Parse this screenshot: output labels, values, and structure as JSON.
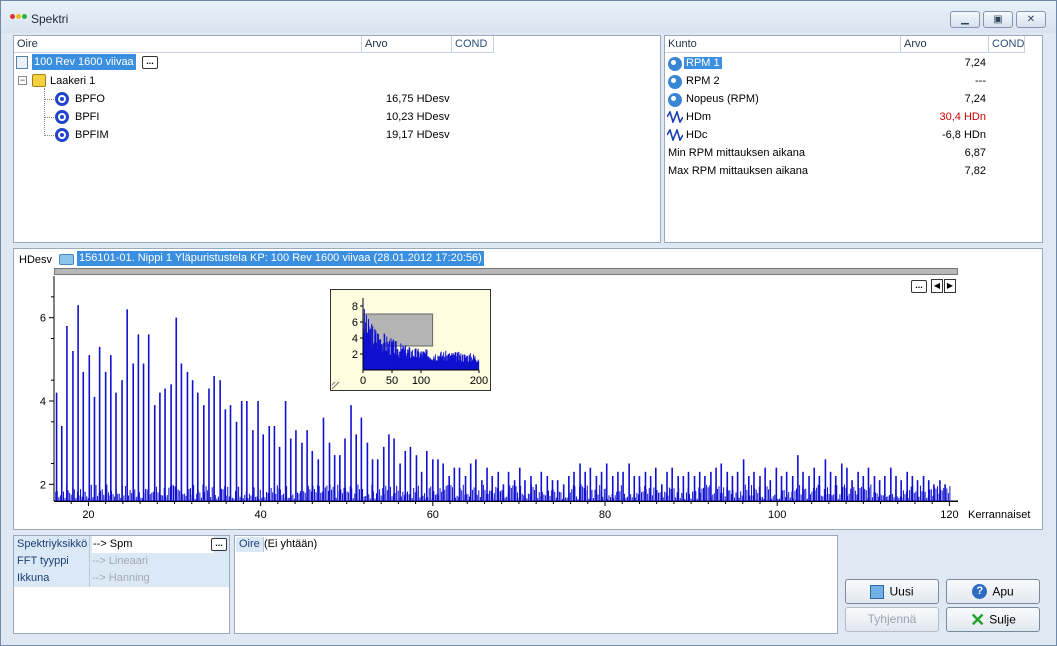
{
  "window": {
    "title": "Spektri",
    "colors": {
      "accent": "#3b8fe0",
      "bars": "#1010d0",
      "alarm": "#d00000"
    }
  },
  "left_table": {
    "headers": [
      "Oire",
      "Arvo",
      "COND"
    ],
    "root": {
      "label": "100 Rev 1600 viivaa",
      "more": "..."
    },
    "group": {
      "label": "Laakeri 1"
    },
    "rows": [
      {
        "name": "BPFO",
        "value": "16,75 HDesv"
      },
      {
        "name": "BPFI",
        "value": "10,23 HDesv"
      },
      {
        "name": "BPFIM",
        "value": "19,17 HDesv"
      }
    ]
  },
  "right_table": {
    "headers": [
      "Kunto",
      "Arvo",
      "COND"
    ],
    "rows": [
      {
        "name": "RPM 1",
        "value": "7,24",
        "icon": "rpm-icon",
        "selected": true
      },
      {
        "name": "RPM 2",
        "value": "---",
        "icon": "rpm-icon"
      },
      {
        "name": "Nopeus (RPM)",
        "value": "7,24",
        "icon": "rpm-icon"
      },
      {
        "name": "HDm",
        "value": "30,4 HDn",
        "icon": "wave-icon",
        "alarm": true
      },
      {
        "name": "HDc",
        "value": "-6,8 HDn",
        "icon": "wave-icon"
      },
      {
        "name": "Min RPM mittauksen aikana",
        "value": "6,87",
        "icon": ""
      },
      {
        "name": "Max RPM mittauksen aikana",
        "value": "7,82",
        "icon": ""
      }
    ]
  },
  "chart": {
    "unit_label": "HDesv",
    "measurement_label": "156101-01. Nippi 1 Yläpuristustela KP: 100 Rev 1600 viivaa (28.01.2012 17:20:56)",
    "nav": {
      "more": "...",
      "prev": "◀",
      "next": "▶"
    }
  },
  "chart_data": [
    {
      "type": "bar",
      "title": "",
      "xlabel": "Kerrannaiset",
      "ylabel": "HDesv",
      "xlim": [
        16,
        121
      ],
      "ylim": [
        1.6,
        7.0
      ],
      "xticks": [
        20,
        40,
        60,
        80,
        100,
        120
      ],
      "yticks": [
        2,
        4,
        6
      ],
      "peaks": [
        [
          16.3,
          4.2
        ],
        [
          16.9,
          3.4
        ],
        [
          17.5,
          5.8
        ],
        [
          18.2,
          5.2
        ],
        [
          18.8,
          6.3
        ],
        [
          19.4,
          4.7
        ],
        [
          20.1,
          5.1
        ],
        [
          20.7,
          4.1
        ],
        [
          21.3,
          5.3
        ],
        [
          22.0,
          4.7
        ],
        [
          22.6,
          5.1
        ],
        [
          23.2,
          4.2
        ],
        [
          23.9,
          4.5
        ],
        [
          24.5,
          6.2
        ],
        [
          25.2,
          4.9
        ],
        [
          25.8,
          5.6
        ],
        [
          26.4,
          4.9
        ],
        [
          27.0,
          5.6
        ],
        [
          27.7,
          3.9
        ],
        [
          28.3,
          4.2
        ],
        [
          28.9,
          4.3
        ],
        [
          29.6,
          4.4
        ],
        [
          30.2,
          6.0
        ],
        [
          30.8,
          4.9
        ],
        [
          31.5,
          4.7
        ],
        [
          32.1,
          4.5
        ],
        [
          32.7,
          4.2
        ],
        [
          33.4,
          3.9
        ],
        [
          34.0,
          4.3
        ],
        [
          34.6,
          4.6
        ],
        [
          35.3,
          4.5
        ],
        [
          35.9,
          3.8
        ],
        [
          36.5,
          3.9
        ],
        [
          37.2,
          3.5
        ],
        [
          37.8,
          4.0
        ],
        [
          38.4,
          4.0
        ],
        [
          39.1,
          3.3
        ],
        [
          39.7,
          4.0
        ],
        [
          40.3,
          3.2
        ],
        [
          41.0,
          3.4
        ],
        [
          41.6,
          3.4
        ],
        [
          42.2,
          2.9
        ],
        [
          42.9,
          4.0
        ],
        [
          43.5,
          3.1
        ],
        [
          44.1,
          3.3
        ],
        [
          44.8,
          3.0
        ],
        [
          45.4,
          3.3
        ],
        [
          46.0,
          2.8
        ],
        [
          46.7,
          2.6
        ],
        [
          47.3,
          3.6
        ],
        [
          48.0,
          3.0
        ],
        [
          48.6,
          2.7
        ],
        [
          49.2,
          2.7
        ],
        [
          49.8,
          3.1
        ],
        [
          50.5,
          3.9
        ],
        [
          51.1,
          3.2
        ],
        [
          51.7,
          3.6
        ],
        [
          52.4,
          3.0
        ],
        [
          53.0,
          2.6
        ],
        [
          53.6,
          2.6
        ],
        [
          54.3,
          2.9
        ],
        [
          54.9,
          3.2
        ],
        [
          55.5,
          3.1
        ],
        [
          56.2,
          2.5
        ],
        [
          56.8,
          2.8
        ],
        [
          57.4,
          2.9
        ],
        [
          58.1,
          2.7
        ],
        [
          58.7,
          2.3
        ],
        [
          59.3,
          2.8
        ],
        [
          60.0,
          2.6
        ],
        [
          60.6,
          2.6
        ],
        [
          61.2,
          2.5
        ],
        [
          61.9,
          2.2
        ],
        [
          62.5,
          2.4
        ],
        [
          63.1,
          2.4
        ],
        [
          63.8,
          2.2
        ],
        [
          64.4,
          2.5
        ],
        [
          65.0,
          2.6
        ],
        [
          65.7,
          2.1
        ],
        [
          66.3,
          2.4
        ],
        [
          66.9,
          2.2
        ],
        [
          67.6,
          2.3
        ],
        [
          68.2,
          2.0
        ],
        [
          68.8,
          2.3
        ],
        [
          69.5,
          2.1
        ],
        [
          70.1,
          2.4
        ],
        [
          70.7,
          2.1
        ],
        [
          71.4,
          2.2
        ],
        [
          72.0,
          2.0
        ],
        [
          72.6,
          2.3
        ],
        [
          73.3,
          2.2
        ],
        [
          73.9,
          2.1
        ],
        [
          74.5,
          2.1
        ],
        [
          75.2,
          2.0
        ],
        [
          75.8,
          2.2
        ],
        [
          76.4,
          2.3
        ],
        [
          77.1,
          2.5
        ],
        [
          77.7,
          2.3
        ],
        [
          78.3,
          2.4
        ],
        [
          79.0,
          2.2
        ],
        [
          79.6,
          2.3
        ],
        [
          80.2,
          2.5
        ],
        [
          80.9,
          2.2
        ],
        [
          81.5,
          2.3
        ],
        [
          82.1,
          2.3
        ],
        [
          82.8,
          2.5
        ],
        [
          83.4,
          2.2
        ],
        [
          84.0,
          2.2
        ],
        [
          84.7,
          2.3
        ],
        [
          85.3,
          2.2
        ],
        [
          85.9,
          2.4
        ],
        [
          86.6,
          2.0
        ],
        [
          87.2,
          2.3
        ],
        [
          87.8,
          2.4
        ],
        [
          88.5,
          2.2
        ],
        [
          89.1,
          2.2
        ],
        [
          89.7,
          2.3
        ],
        [
          90.4,
          2.2
        ],
        [
          91.0,
          2.3
        ],
        [
          91.6,
          2.2
        ],
        [
          92.3,
          2.3
        ],
        [
          92.9,
          2.4
        ],
        [
          93.5,
          2.5
        ],
        [
          94.2,
          2.3
        ],
        [
          94.8,
          2.2
        ],
        [
          95.4,
          2.3
        ],
        [
          96.1,
          2.6
        ],
        [
          96.7,
          2.2
        ],
        [
          97.3,
          2.3
        ],
        [
          98.0,
          2.2
        ],
        [
          98.6,
          2.4
        ],
        [
          99.2,
          2.1
        ],
        [
          99.9,
          2.4
        ],
        [
          100.5,
          2.2
        ],
        [
          101.1,
          2.3
        ],
        [
          101.8,
          2.2
        ],
        [
          102.4,
          2.7
        ],
        [
          103.0,
          2.3
        ],
        [
          103.7,
          2.2
        ],
        [
          104.3,
          2.4
        ],
        [
          104.9,
          2.2
        ],
        [
          105.6,
          2.6
        ],
        [
          106.2,
          2.3
        ],
        [
          106.8,
          2.2
        ],
        [
          107.5,
          2.5
        ],
        [
          108.1,
          2.4
        ],
        [
          108.7,
          2.1
        ],
        [
          109.4,
          2.3
        ],
        [
          110.0,
          2.2
        ],
        [
          110.6,
          2.4
        ],
        [
          111.3,
          2.2
        ],
        [
          111.9,
          2.1
        ],
        [
          112.5,
          2.2
        ],
        [
          113.2,
          2.4
        ],
        [
          113.8,
          2.2
        ],
        [
          114.4,
          2.1
        ],
        [
          115.1,
          2.3
        ],
        [
          115.7,
          2.2
        ],
        [
          116.3,
          2.1
        ],
        [
          117.0,
          2.2
        ],
        [
          117.6,
          2.1
        ],
        [
          118.2,
          2.0
        ],
        [
          118.9,
          2.1
        ],
        [
          119.5,
          2.0
        ]
      ]
    },
    {
      "type": "area",
      "title": "",
      "xlim": [
        0,
        200
      ],
      "ylim": [
        0,
        9
      ],
      "xticks": [
        0,
        50,
        100,
        200
      ],
      "yticks": [
        2,
        4,
        6,
        8
      ],
      "shape": [
        [
          0,
          8.2
        ],
        [
          5,
          6.8
        ],
        [
          10,
          6.2
        ],
        [
          20,
          5.4
        ],
        [
          30,
          4.9
        ],
        [
          40,
          4.3
        ],
        [
          50,
          3.8
        ],
        [
          60,
          3.4
        ],
        [
          70,
          3.1
        ],
        [
          80,
          2.9
        ],
        [
          90,
          2.7
        ],
        [
          100,
          2.6
        ],
        [
          120,
          2.4
        ],
        [
          140,
          2.3
        ],
        [
          160,
          2.2
        ],
        [
          180,
          2.1
        ],
        [
          200,
          2.0
        ]
      ],
      "zoom_window": {
        "x": [
          0,
          120
        ],
        "y": [
          3.0,
          7.0
        ]
      }
    }
  ],
  "props_table": {
    "rows": [
      {
        "name": "Spektriyksikkö",
        "value": "--> Spm",
        "more": "..."
      },
      {
        "name": "FFT tyyppi",
        "value": "--> Lineaari"
      },
      {
        "name": "Ikkuna",
        "value": "--> Hanning"
      }
    ]
  },
  "list_panel": {
    "label": "Oire",
    "value": "(Ei yhtään)"
  },
  "buttons": {
    "new": "Uusi",
    "clear": "Tyhjennä",
    "help": "Apu",
    "close": "Sulje"
  }
}
